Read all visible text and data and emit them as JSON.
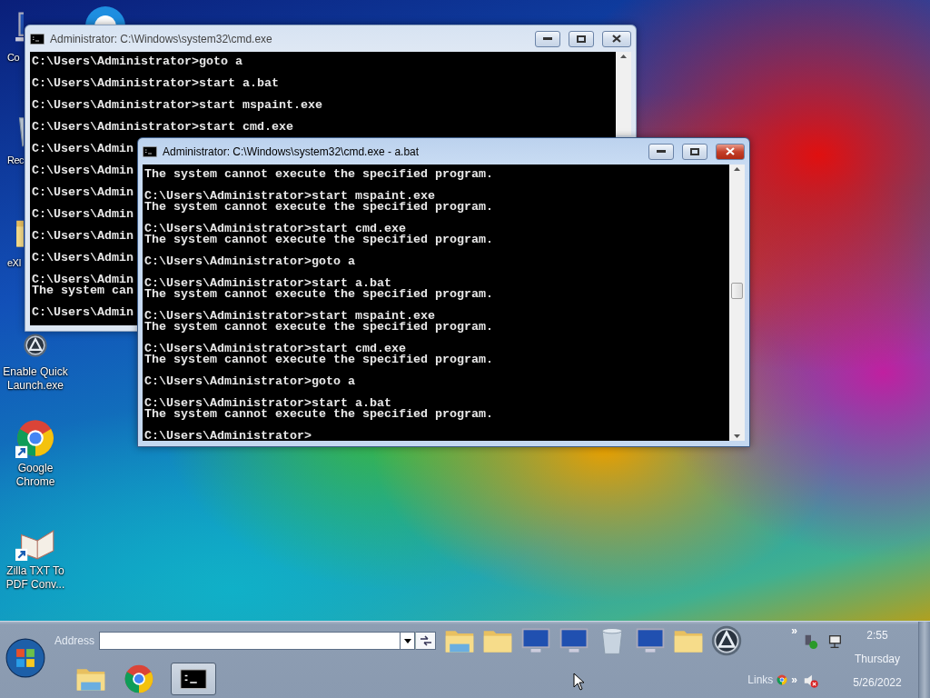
{
  "desktop_icons": [
    {
      "label": "Co",
      "kind": "covered"
    },
    {
      "label": "Rec",
      "kind": "covered"
    },
    {
      "label": "eXI",
      "kind": "covered"
    },
    {
      "label": "Enable Quick Launch.exe",
      "kind": "full"
    },
    {
      "label": "Google Chrome",
      "kind": "full"
    },
    {
      "label": "Zilla TXT To PDF Conv...",
      "kind": "full"
    }
  ],
  "windows": [
    {
      "title": "Administrator: C:\\Windows\\system32\\cmd.exe",
      "active": false,
      "console": [
        [
          "C:\\Users\\Administrator>goto a"
        ],
        [
          "C:\\Users\\Administrator>start a.bat"
        ],
        [
          "C:\\Users\\Administrator>start mspaint.exe"
        ],
        [
          "C:\\Users\\Administrator>start cmd.exe"
        ],
        [
          "C:\\Users\\Admin"
        ],
        [
          "C:\\Users\\Admin"
        ],
        [
          "C:\\Users\\Admin"
        ],
        [
          "C:\\Users\\Admin"
        ],
        [
          "C:\\Users\\Admin"
        ],
        [
          "C:\\Users\\Admin"
        ],
        [
          "C:\\Users\\Admin",
          "The system can"
        ],
        [
          "C:\\Users\\Admin"
        ]
      ]
    },
    {
      "title": "Administrator: C:\\Windows\\system32\\cmd.exe - a.bat",
      "active": true,
      "console": [
        [
          "The system cannot execute the specified program."
        ],
        [
          "C:\\Users\\Administrator>start mspaint.exe",
          "The system cannot execute the specified program."
        ],
        [
          "C:\\Users\\Administrator>start cmd.exe",
          "The system cannot execute the specified program."
        ],
        [
          "C:\\Users\\Administrator>goto a"
        ],
        [
          "C:\\Users\\Administrator>start a.bat",
          "The system cannot execute the specified program."
        ],
        [
          "C:\\Users\\Administrator>start mspaint.exe",
          "The system cannot execute the specified program."
        ],
        [
          "C:\\Users\\Administrator>start cmd.exe",
          "The system cannot execute the specified program."
        ],
        [
          "C:\\Users\\Administrator>goto a"
        ],
        [
          "C:\\Users\\Administrator>start a.bat",
          "The system cannot execute the specified program."
        ],
        [
          "C:\\Users\\Administrator>"
        ]
      ]
    }
  ],
  "taskbar": {
    "address_label": "Address",
    "task_buttons": [
      {
        "selected": true
      }
    ],
    "chevrons": [
      "»",
      "»"
    ],
    "links_label": "Links",
    "clock": {
      "time": "2:55",
      "day": "Thursday",
      "date": "5/26/2022"
    }
  }
}
